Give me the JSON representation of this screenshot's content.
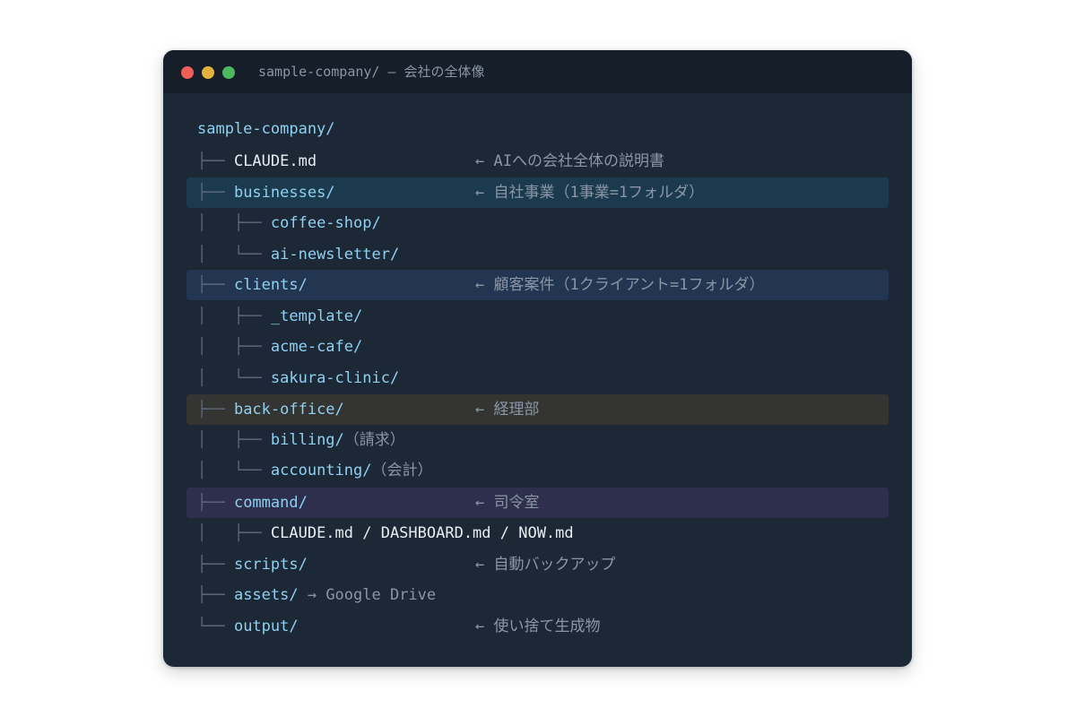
{
  "window": {
    "title": "sample-company/ — 会社の全体像",
    "traffic_lights": [
      "#ee5f57",
      "#e3b23c",
      "#4cb860"
    ]
  },
  "tree": {
    "root": "sample-company/",
    "rows": [
      {
        "prefix": "├── ",
        "name": "CLAUDE.md",
        "comment": "← AIへの会社全体の説明書"
      },
      {
        "prefix": "├── ",
        "name": "businesses/",
        "comment": "← 自社事業（1事業=1フォルダ）"
      },
      {
        "prefix": "│   ├── ",
        "name": "coffee-shop/",
        "comment": ""
      },
      {
        "prefix": "│   └── ",
        "name": "ai-newsletter/",
        "comment": ""
      },
      {
        "prefix": "├── ",
        "name": "clients/",
        "comment": "← 顧客案件（1クライアント=1フォルダ）"
      },
      {
        "prefix": "│   ├── ",
        "name": "_template/",
        "comment": ""
      },
      {
        "prefix": "│   ├── ",
        "name": "acme-cafe/",
        "comment": ""
      },
      {
        "prefix": "│   └── ",
        "name": "sakura-clinic/",
        "comment": ""
      },
      {
        "prefix": "├── ",
        "name": "back-office/",
        "comment": "← 経理部"
      },
      {
        "prefix": "│   ├── ",
        "name": "billing/",
        "comment": "（請求）"
      },
      {
        "prefix": "│   └── ",
        "name": "accounting/",
        "comment": "（会計）"
      },
      {
        "prefix": "├── ",
        "name": "command/",
        "comment": "← 司令室"
      },
      {
        "prefix": "│   ├── ",
        "name": "CLAUDE.md / DASHBOARD.md / NOW.md",
        "comment": ""
      },
      {
        "prefix": "├── ",
        "name": "scripts/",
        "comment": "← 自動バックアップ"
      },
      {
        "prefix": "├── ",
        "name": "assets/",
        "comment": " → Google Drive"
      },
      {
        "prefix": "└── ",
        "name": "output/",
        "comment": "← 使い捨て生成物"
      }
    ]
  },
  "highlight_colors": {
    "businesses": "#1c3a4d",
    "clients": "#223651",
    "back_office": "#343432",
    "command": "#2e2f4c"
  }
}
